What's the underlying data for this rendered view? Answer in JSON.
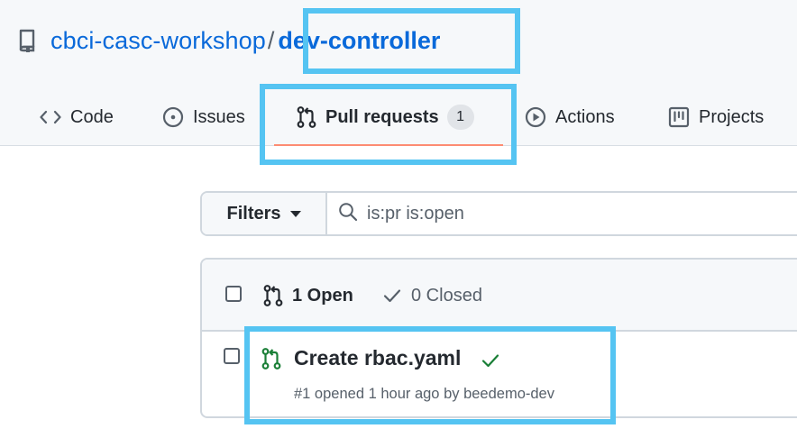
{
  "repo": {
    "owner": "cbci-casc-workshop",
    "separator": "/",
    "name": "dev-controller",
    "icon": "repo-icon"
  },
  "tabs": [
    {
      "label": "Code",
      "icon": "code-icon"
    },
    {
      "label": "Issues",
      "icon": "issue-opened-icon"
    },
    {
      "label": "Pull requests",
      "icon": "git-pull-request-icon",
      "count": "1",
      "selected": true
    },
    {
      "label": "Actions",
      "icon": "play-icon"
    },
    {
      "label": "Projects",
      "icon": "project-icon"
    }
  ],
  "filters": {
    "button_label": "Filters",
    "search_value": "is:pr is:open"
  },
  "list": {
    "open_label": "1 Open",
    "closed_label": "0 Closed",
    "items": [
      {
        "title": "Create rbac.yaml",
        "status": "checks-passed",
        "meta": "#1 opened 1 hour ago by beedemo-dev"
      }
    ]
  },
  "colors": {
    "link": "#0969da",
    "open_green": "#1a7f37",
    "tab_underline": "#fd8c73",
    "highlight": "#55c4f2"
  }
}
